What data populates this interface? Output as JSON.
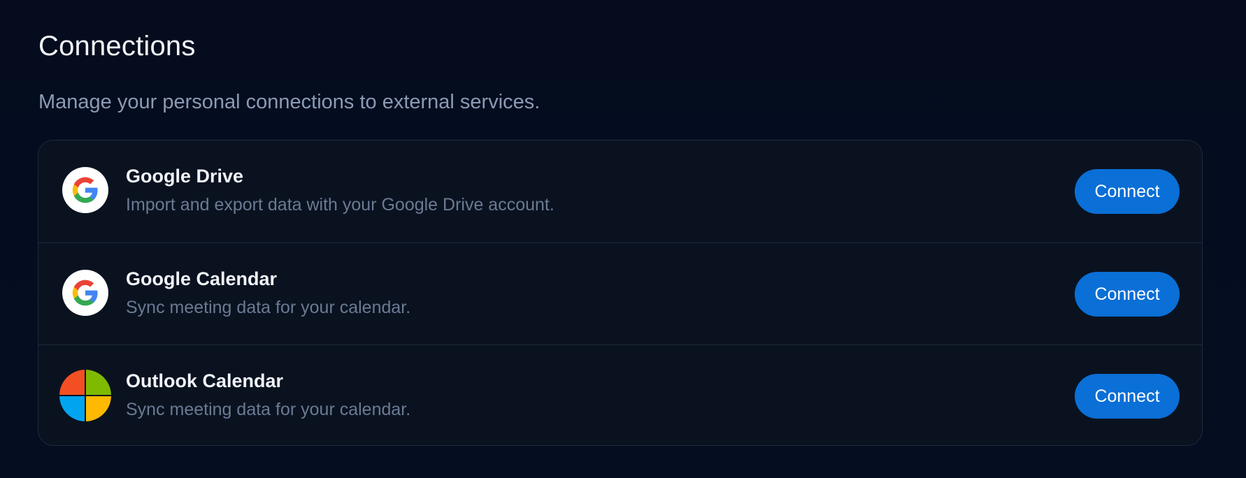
{
  "header": {
    "title": "Connections",
    "subtitle": "Manage your personal connections to external services."
  },
  "connections": [
    {
      "name": "Google Drive",
      "description": "Import and export data with your Google Drive account.",
      "icon": "google-icon",
      "button_label": "Connect"
    },
    {
      "name": "Google Calendar",
      "description": "Sync meeting data for your calendar.",
      "icon": "google-icon",
      "button_label": "Connect"
    },
    {
      "name": "Outlook Calendar",
      "description": "Sync meeting data for your calendar.",
      "icon": "microsoft-icon",
      "button_label": "Connect"
    }
  ],
  "colors": {
    "background": "#040c1e",
    "card": "#0a1220",
    "border": "#1e293b",
    "accent": "#0a6fd6",
    "google_blue": "#4285F4",
    "google_red": "#EA4335",
    "google_yellow": "#FBBC05",
    "google_green": "#34A853",
    "ms_red": "#F25022",
    "ms_green": "#7FBA00",
    "ms_blue": "#00A4EF",
    "ms_yellow": "#FFB900"
  }
}
